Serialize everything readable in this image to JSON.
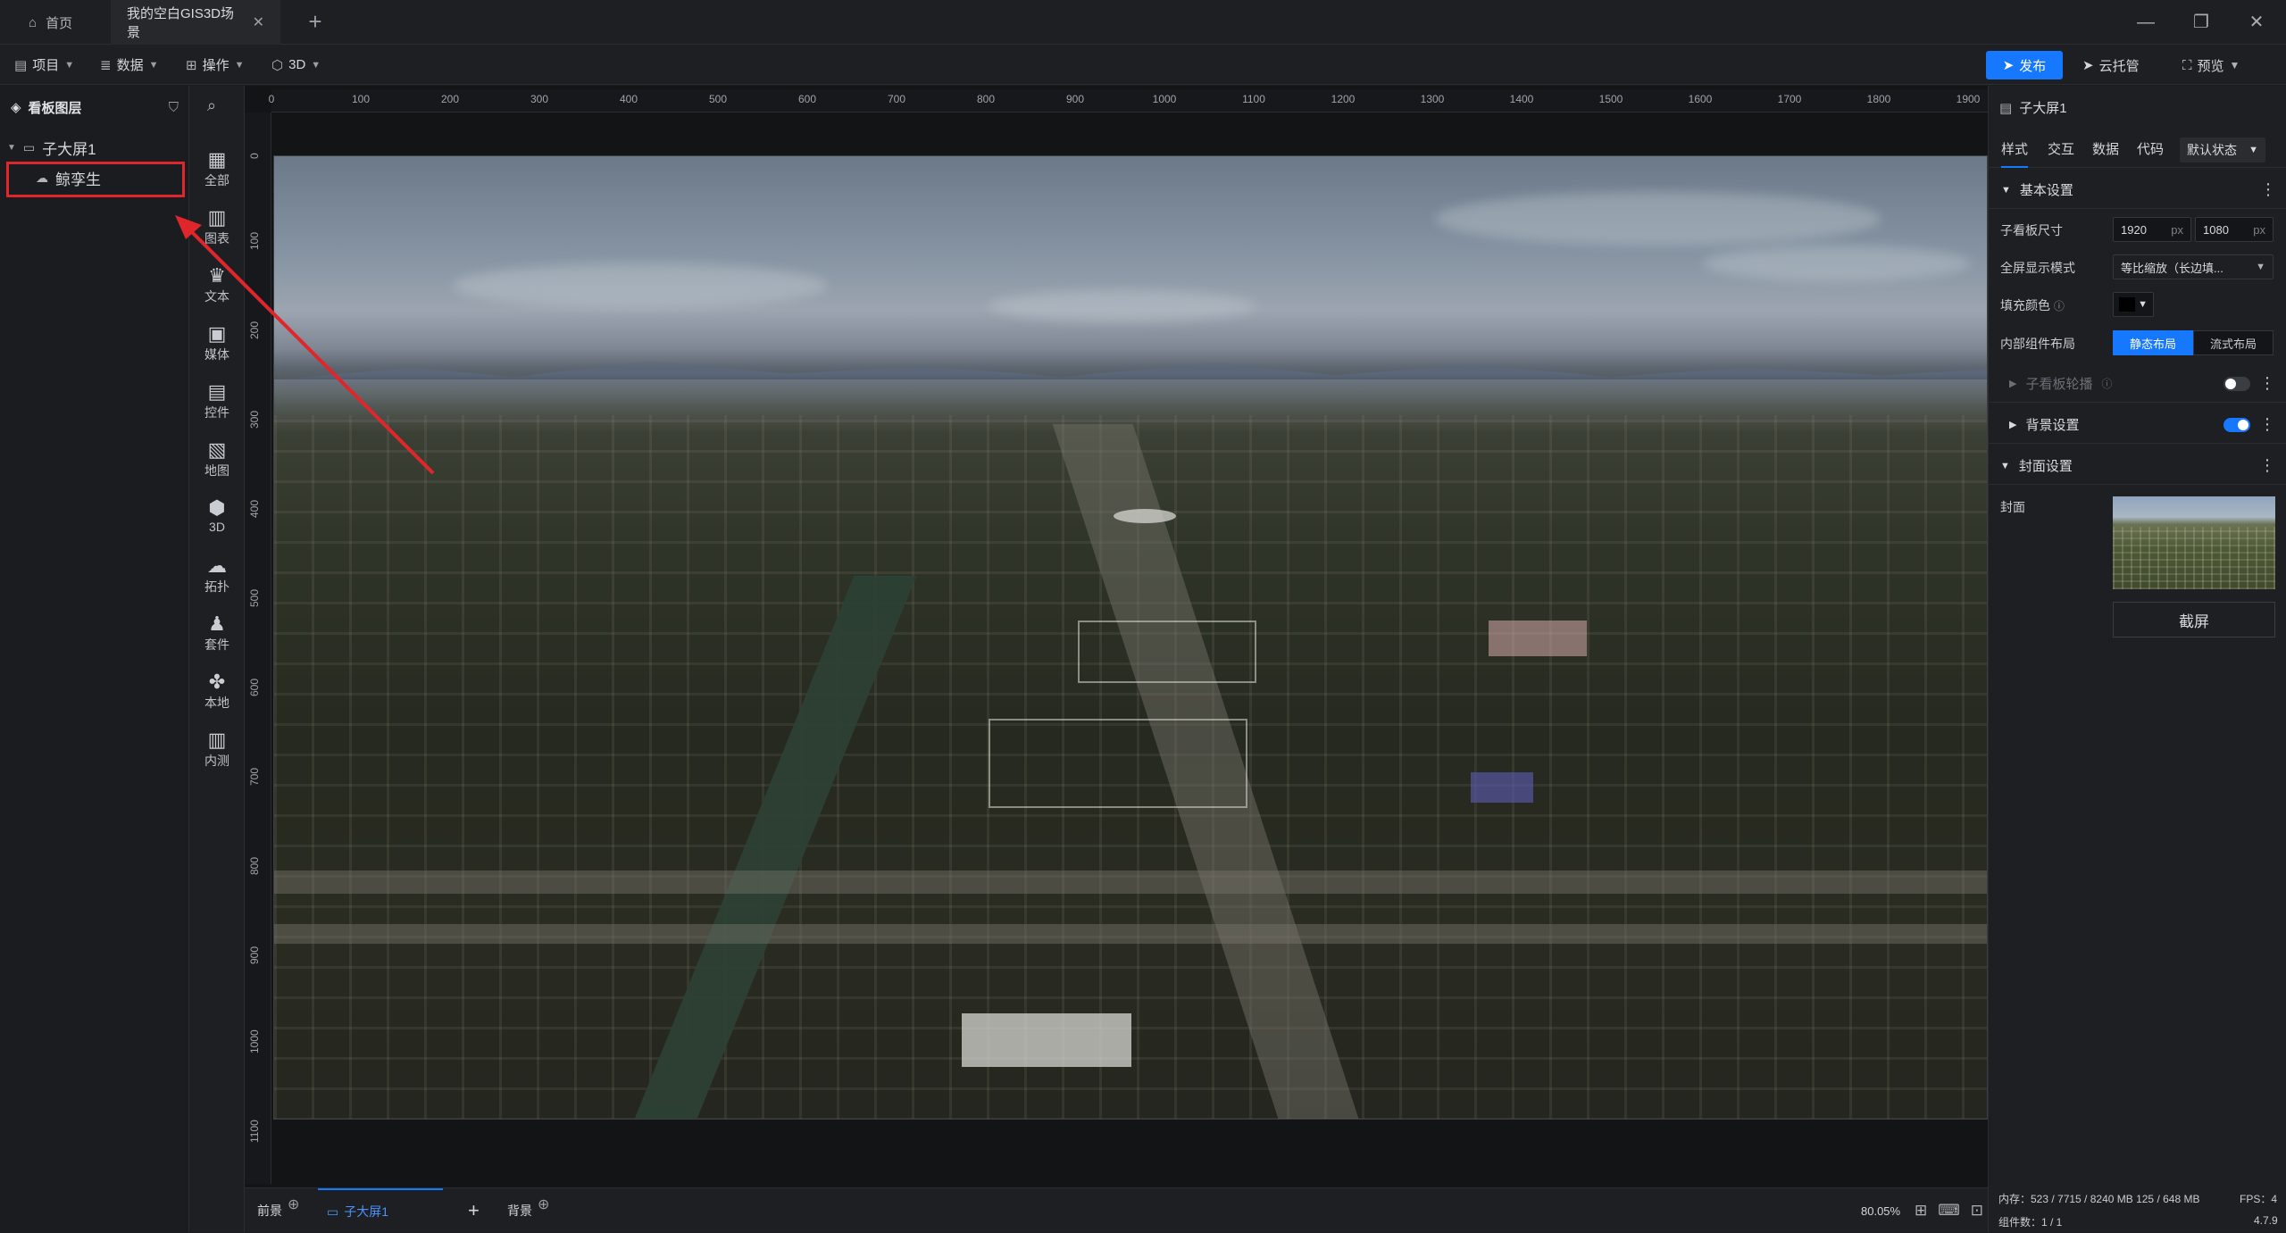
{
  "window": {
    "tabs": [
      {
        "label": "首页",
        "icon": "home-icon"
      },
      {
        "label": "我的空白GIS3D场景",
        "icon": ""
      }
    ],
    "new_tab": "+",
    "controls": {
      "minimize": "—",
      "restore": "❐",
      "close": "✕"
    }
  },
  "toolbar": {
    "menus": [
      "项目",
      "数据",
      "操作",
      "3D"
    ],
    "publish": "发布",
    "cloud": "云托管",
    "preview": "预览"
  },
  "layers": {
    "title": "看板图层",
    "root": "子大屏1",
    "child": "鲸孪生"
  },
  "categories": [
    "全部",
    "图表",
    "文本",
    "媒体",
    "控件",
    "地图",
    "3D",
    "拓扑",
    "套件",
    "本地",
    "内测"
  ],
  "ruler": {
    "h": [
      "0",
      "100",
      "200",
      "300",
      "400",
      "500",
      "600",
      "700",
      "800",
      "900",
      "1000",
      "1100",
      "1200",
      "1300",
      "1400",
      "1500",
      "1600",
      "1700",
      "1800",
      "1900"
    ],
    "v": [
      "0",
      "100",
      "200",
      "300",
      "400",
      "500",
      "600",
      "700",
      "800",
      "900",
      "1000",
      "1100"
    ]
  },
  "footer": {
    "foreground": "前景",
    "screen_tab": "子大屏1",
    "background": "背景",
    "zoom": "80.05%"
  },
  "properties": {
    "title": "子大屏1",
    "tabs": [
      "样式",
      "交互",
      "数据",
      "代码"
    ],
    "state": "默认状态",
    "section_basic": "基本设置",
    "size_label": "子看板尺寸",
    "width": "1920",
    "height": "1080",
    "unit": "px",
    "fullscreen_label": "全屏显示模式",
    "fullscreen_value": "等比缩放（长边填...",
    "fill_label": "填充颜色",
    "layout_label": "内部组件布局",
    "layout_static": "静态布局",
    "layout_flow": "流式布局",
    "section_carousel": "子看板轮播",
    "section_background": "背景设置",
    "section_cover": "封面设置",
    "cover_label": "封面",
    "screenshot": "截屏",
    "fill_color": "#000000",
    "accent": "#1677ff"
  },
  "status": {
    "memory": "内存：523 / 7715 / 8240 MB  125 / 648 MB",
    "fps": "FPS：4",
    "components": "组件数：1 / 1",
    "version": "4.7.9"
  }
}
